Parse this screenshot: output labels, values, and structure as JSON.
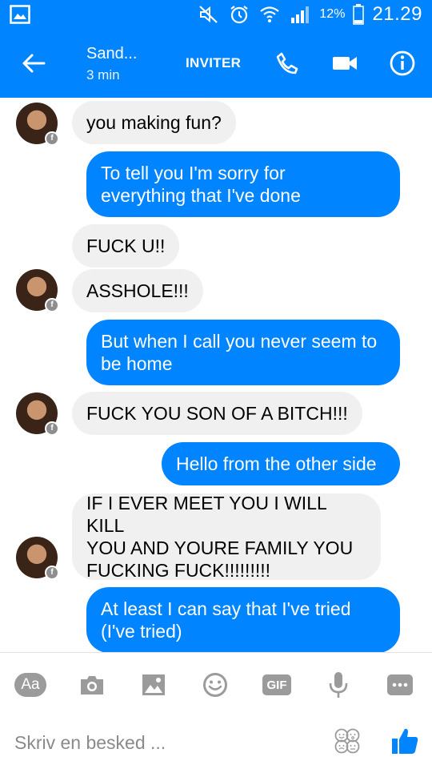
{
  "status_bar": {
    "battery_percent": "12%",
    "time": "21.29",
    "icons": [
      "gallery-notification-icon",
      "mute-icon",
      "alarm-icon",
      "wifi-icon",
      "signal-icon",
      "battery-icon"
    ]
  },
  "header": {
    "contact_name": "Sand...",
    "contact_status": "3 min",
    "invite_label": "INVITER",
    "icons": [
      "back-arrow-icon",
      "phone-icon",
      "video-camera-icon",
      "info-icon"
    ],
    "accent_color": "#0084ff"
  },
  "messages": [
    {
      "direction": "incoming",
      "text": "you making fun?",
      "avatar": true
    },
    {
      "direction": "outgoing",
      "lines": [
        "To tell you I'm sorry for",
        "everything that I've done"
      ]
    },
    {
      "direction": "incoming",
      "text": "FUCK U!!",
      "avatar": false
    },
    {
      "direction": "incoming",
      "text": "ASSHOLE!!!",
      "avatar": true
    },
    {
      "direction": "outgoing",
      "lines": [
        "But when I call you never seem to",
        "be home"
      ]
    },
    {
      "direction": "incoming",
      "text": "FUCK YOU SON OF A BITCH!!!",
      "avatar": true
    },
    {
      "direction": "outgoing",
      "text": "Hello from the other side"
    },
    {
      "direction": "incoming",
      "lines": [
        "IF I EVER MEET YOU I WILL KILL",
        "YOU AND YOURE FAMILY YOU",
        "FUCKING FUCK!!!!!!!!!"
      ],
      "avatar": true
    },
    {
      "direction": "outgoing",
      "lines": [
        "At least I can say that I've tried",
        "(I've tried)"
      ]
    }
  ],
  "composer": {
    "text_tool_label": "Aa",
    "gif_label": "GIF",
    "placeholder": "Skriv en besked ...",
    "icons": [
      "camera-icon",
      "image-icon",
      "smiley-icon",
      "microphone-icon",
      "more-icon",
      "emoji-picker-icon",
      "thumbs-up-icon"
    ]
  }
}
